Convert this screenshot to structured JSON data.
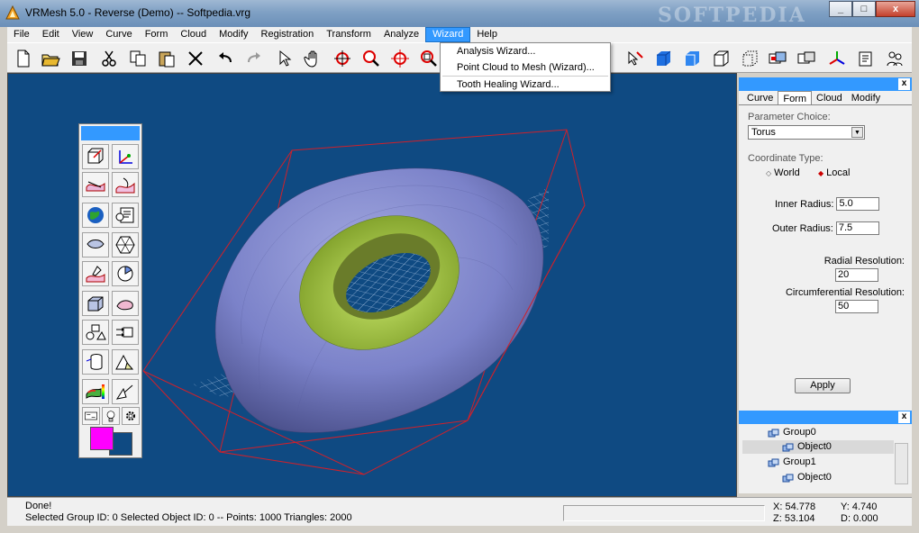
{
  "window": {
    "title": "VRMesh 5.0 - Reverse (Demo) -- Softpedia.vrg",
    "watermark": "SOFTPEDIA",
    "minimize": "_",
    "maximize": "□",
    "close": "x"
  },
  "menu": [
    "File",
    "Edit",
    "View",
    "Curve",
    "Form",
    "Cloud",
    "Modify",
    "Registration",
    "Transform",
    "Analyze",
    "Wizard",
    "Help"
  ],
  "wizard_menu": {
    "items": [
      "Analysis Wizard...",
      "Point Cloud to Mesh (Wizard)...",
      "Tooth Healing Wizard..."
    ]
  },
  "toolbar": {
    "icons": [
      "new-file-icon",
      "open-folder-icon",
      "save-icon",
      "cut-icon",
      "copy-icon",
      "paste-icon",
      "delete-icon",
      "undo-icon",
      "redo-icon",
      "select-arrow-icon",
      "pan-hand-icon",
      "rotate-icon",
      "zoom-icon",
      "zoom-extents-icon",
      "zoom-window-icon",
      "select-point-icon",
      "solid-cube-icon",
      "solid-cube-light-icon",
      "wire-cube-icon",
      "dotted-cube-icon",
      "view-box-icon",
      "view-box-alt-icon",
      "axes-icon",
      "properties-icon",
      "settings-people-icon"
    ]
  },
  "palette": {
    "tools": [
      "transform-icon",
      "axis-align-icon",
      "surface-edit-icon",
      "surface-smooth-icon",
      "globe-icon",
      "mesh-info-icon",
      "patch-icon",
      "hexagon-icon",
      "paint-surface-icon",
      "pie-section-icon",
      "cube-select-icon",
      "shape-icon",
      "cluster-icon",
      "move-objects-icon",
      "cylinder-icon",
      "triangle-icon",
      "color-map-icon",
      "measure-icon",
      "network-icon",
      "lightbulb-icon",
      "gear-icon"
    ],
    "foreground_color": "#ff00ff",
    "background_color": "#0f4a82"
  },
  "panel": {
    "tabs": [
      "Curve",
      "Form",
      "Cloud",
      "Modify"
    ],
    "active_tab": "Form",
    "parameter_choice_label": "Parameter Choice:",
    "parameter_choice_value": "Torus",
    "coordinate_type_label": "Coordinate Type:",
    "coord_world": "World",
    "coord_local": "Local",
    "inner_radius_label": "Inner Radius:",
    "inner_radius_value": "5.0",
    "outer_radius_label": "Outer Radius:",
    "outer_radius_value": "7.5",
    "radial_res_label": "Radial Resolution:",
    "radial_res_value": "20",
    "circ_res_label": "Circumferential Resolution:",
    "circ_res_value": "50",
    "apply_label": "Apply"
  },
  "tree": {
    "items": [
      "Group0",
      "Object0",
      "Group1",
      "Object0"
    ]
  },
  "status": {
    "line1": "Done!",
    "line2": "Selected Group ID: 0   Selected Object ID: 0   -- Points: 1000  Triangles: 2000",
    "x": "X: 54.778",
    "y": "Y: 4.740",
    "z": "Z: 53.104",
    "d": "D: 0.000"
  },
  "colors": {
    "viewport_bg": "#0f4a82",
    "torus_outer": "#7b82c9",
    "torus_inner": "#9bc43a",
    "bbox": "#d0202a",
    "accent": "#3399ff"
  }
}
